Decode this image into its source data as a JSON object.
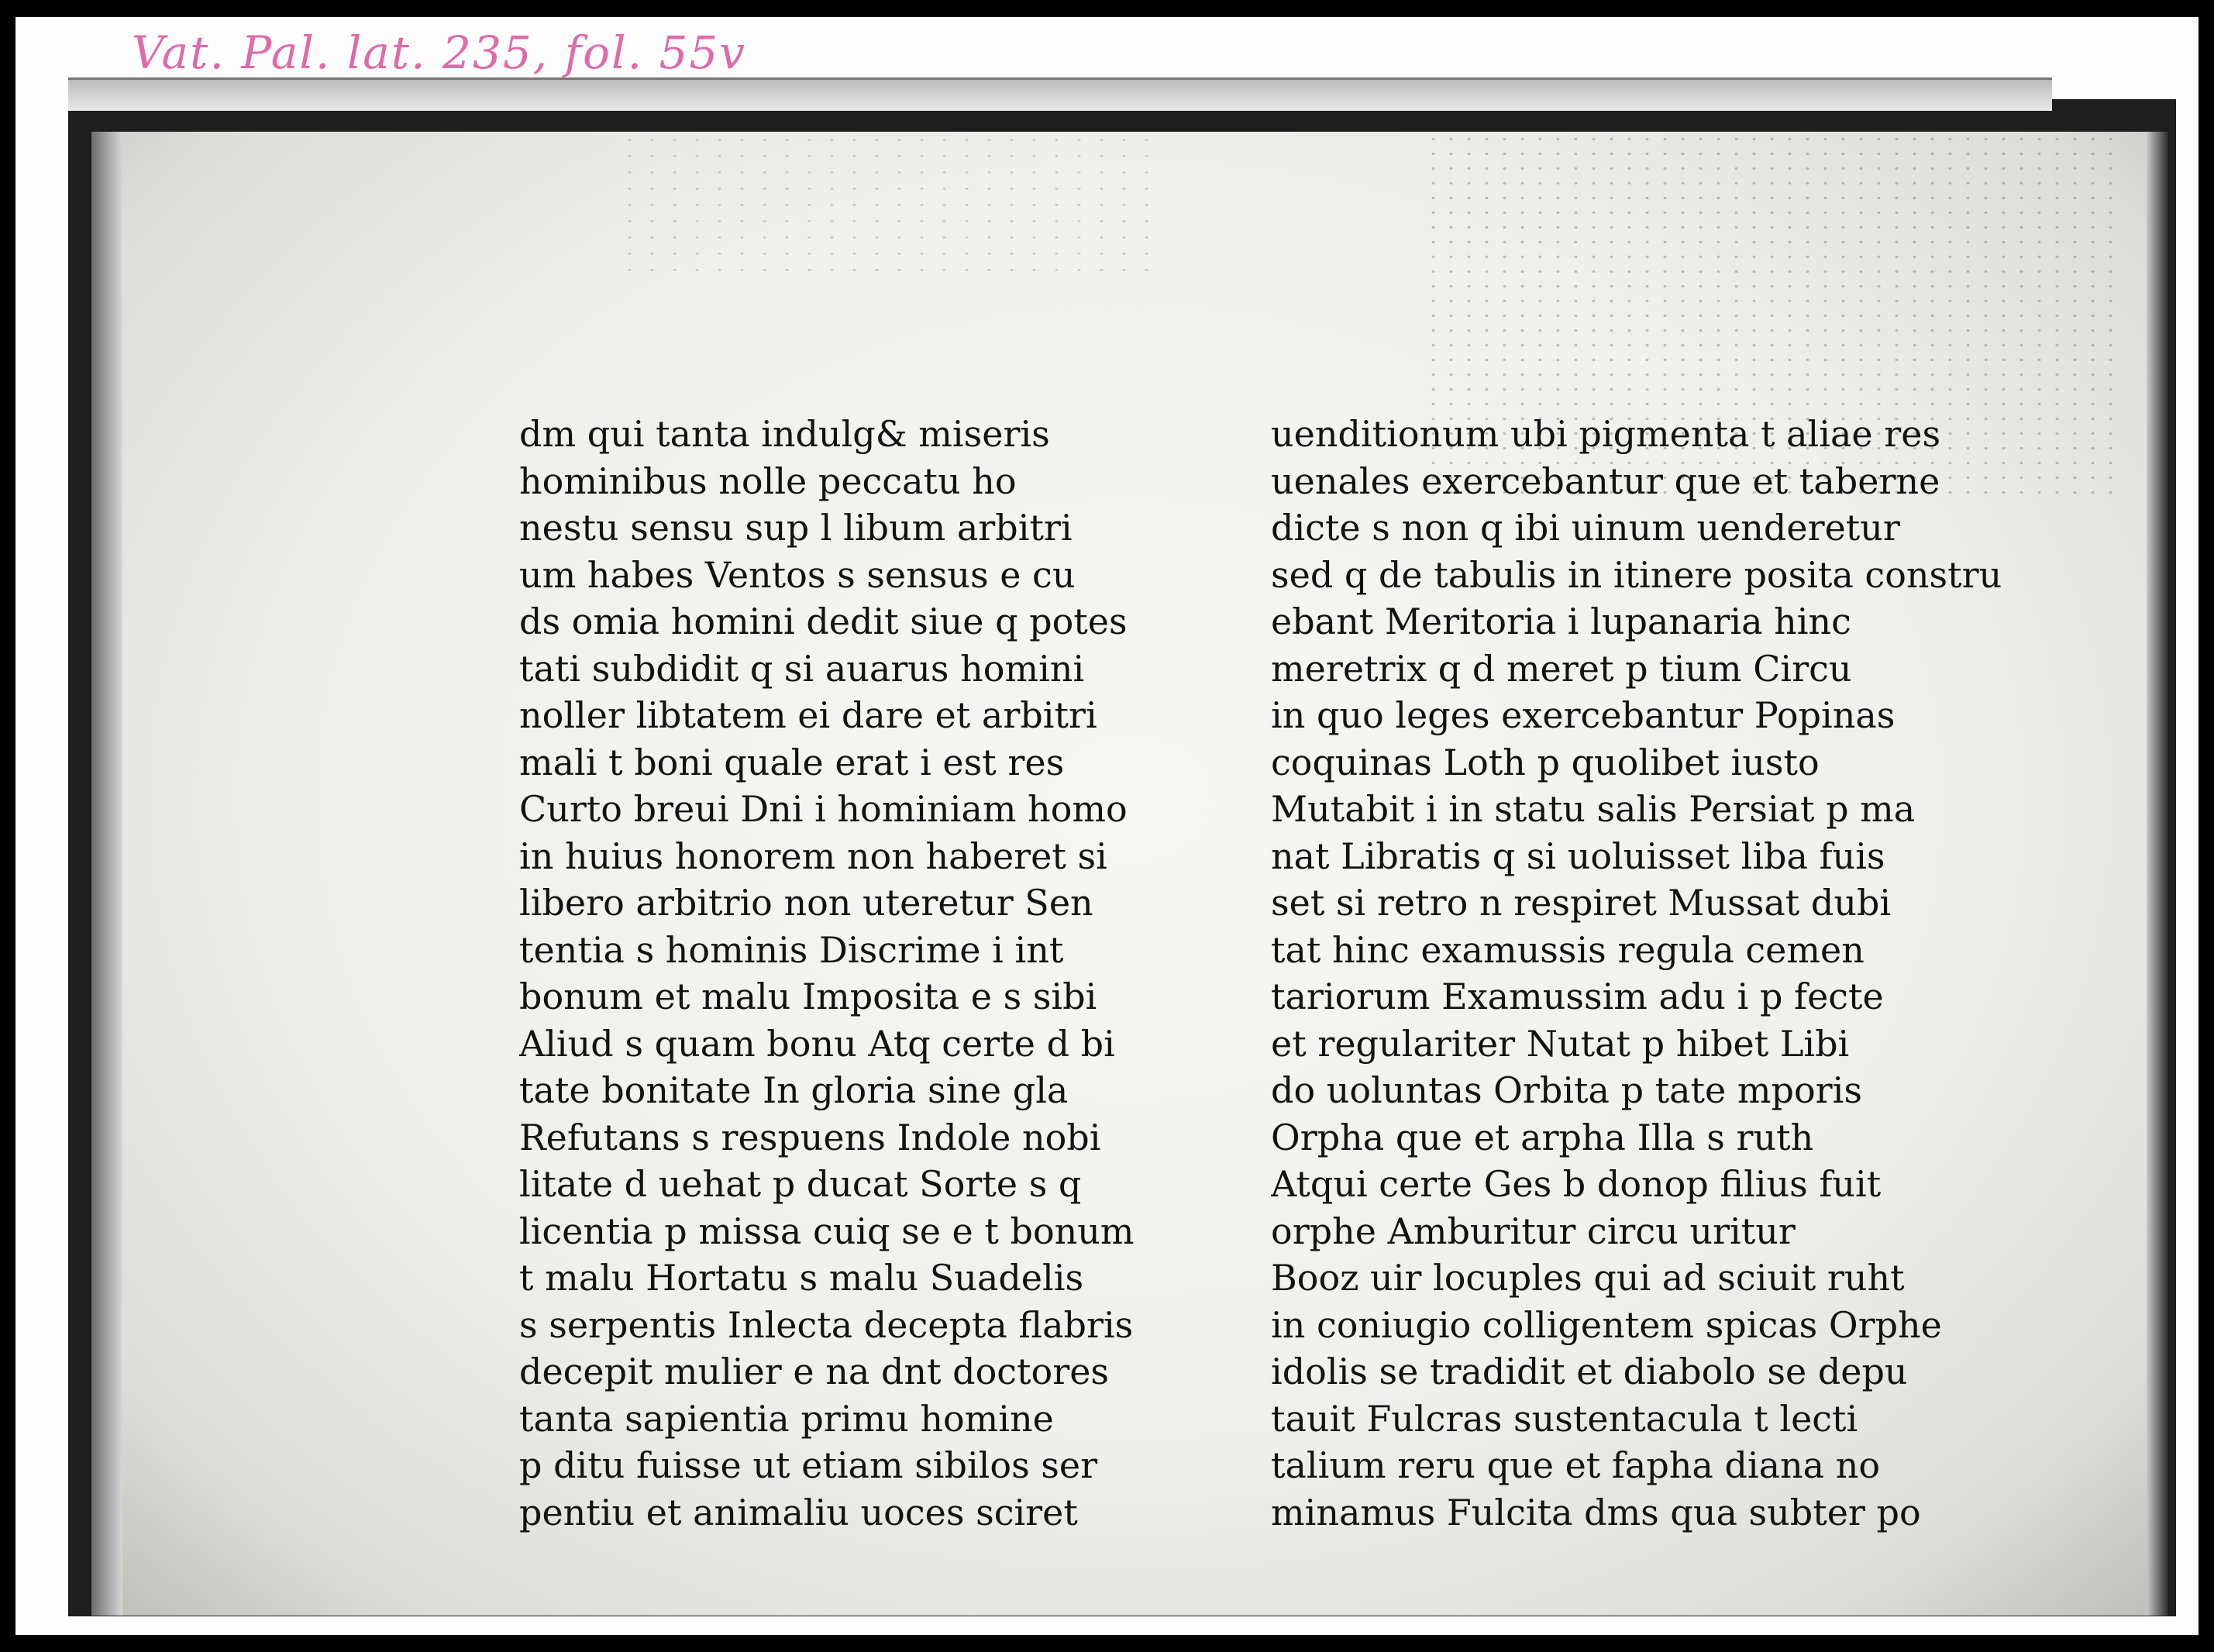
{
  "annotation": "Vat. Pal. lat. 235, fol. 55v",
  "left_column": [
    "dm qui tanta indulg& miseris",
    "hominibus nolle peccatu ho",
    "nestu sensu sup l libum arbitri",
    "um habes Ventos s sensus e cu",
    "ds omia homini dedit siue q potes",
    "tati subdidit q si auarus homini",
    "noller libtatem ei dare et arbitri",
    "mali t boni quale erat i est res",
    "Curto breui Dni i hominiam homo",
    "in huius honorem non haberet si",
    "libero arbitrio non uteretur Sen",
    "tentia s hominis Discrime i int",
    "bonum et malu Imposita e s sibi",
    "Aliud s quam bonu Atq certe d bi",
    "tate bonitate In gloria sine gla",
    "Refutans s respuens Indole nobi",
    "litate d uehat p ducat Sorte s q",
    "licentia p missa cuiq se e t bonum",
    "t malu Hortatu s malu Suadelis",
    "s serpentis Inlecta decepta flabris",
    "decepit mulier e na dnt doctores",
    "tanta sapientia primu homine",
    "p ditu fuisse ut etiam sibilos ser",
    "pentiu et animaliu uoces sciret"
  ],
  "right_column": [
    "uenditionum ubi pigmenta t aliae res",
    "uenales exercebantur que et taberne",
    "dicte s non q ibi uinum uenderetur",
    "sed q de tabulis in itinere posita constru",
    "ebant Meritoria i lupanaria hinc",
    "meretrix q d meret p tium Circu",
    "in quo leges exercebantur Popinas",
    "coquinas Loth p quolibet iusto",
    "Mutabit i in statu salis Persiat p ma",
    "nat Libratis q si uoluisset liba fuis",
    "set si retro n respiret Mussat dubi",
    "tat hinc examussis regula cemen",
    "tariorum Examussim adu i p fecte",
    "et regulariter Nutat p hibet Libi",
    "do uoluntas Orbita p tate mporis",
    "Orpha que et arpha Illa s ruth",
    "Atqui certe Ges b donop filius fuit",
    "orphe Amburitur circu uritur",
    "Booz uir locuples qui ad sciuit ruht",
    "in coniugio colligentem spicas Orphe",
    "idolis se tradidit et diabolo se depu",
    "tauit Fulcras sustentacula t lecti",
    "talium reru que et fapha diana no",
    "minamus Fulcita dms qua subter po"
  ]
}
